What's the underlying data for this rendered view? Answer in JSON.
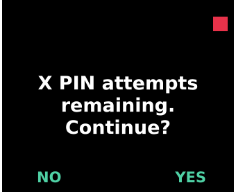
{
  "dialog": {
    "message_lines": [
      "X PIN attempts",
      "remaining.",
      "Continue?"
    ],
    "no_label": "NO",
    "yes_label": "YES"
  },
  "colors": {
    "background": "#000000",
    "text": "#ffffff",
    "softkey": "#4fd1a5",
    "status_indicator": "#e8324a"
  },
  "icons": {
    "status_indicator": "red-square-icon",
    "pointer": "caret-down-icon"
  }
}
